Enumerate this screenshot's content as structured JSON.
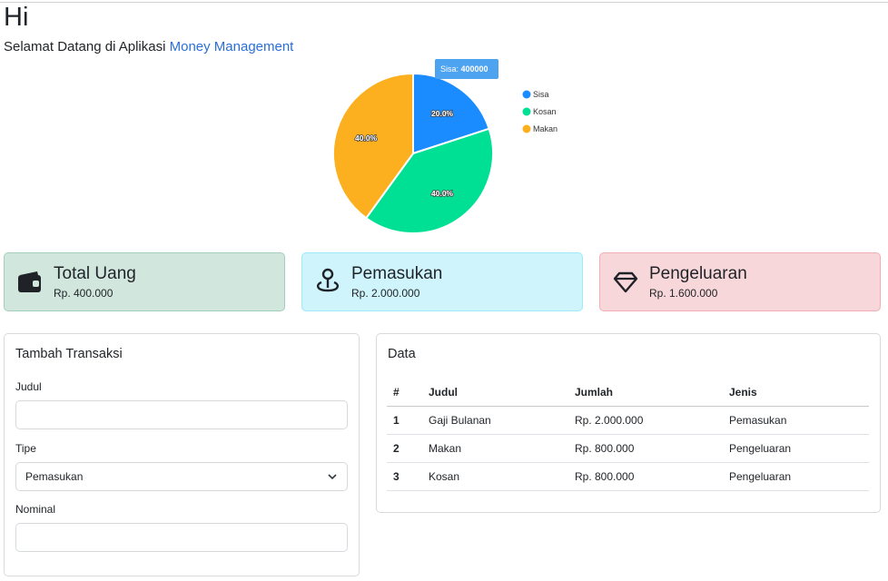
{
  "greeting": "Hi",
  "welcome": {
    "prefix": "Selamat Datang di Aplikasi",
    "brand": "Money Management"
  },
  "colors": {
    "sisa": "#1a8cff",
    "kosan": "#00e094",
    "makan": "#fdb01f",
    "brand": "#2b6fd6"
  },
  "chart_data": {
    "type": "pie",
    "categories": [
      "Sisa",
      "Kosan",
      "Makan"
    ],
    "values": [
      400000,
      800000,
      800000
    ],
    "percent_labels": [
      "20.0%",
      "40.0%",
      "40.0%"
    ],
    "legend_placement": "right",
    "tooltip": {
      "label": "Sisa:",
      "value": "400000"
    }
  },
  "cards": {
    "total": {
      "title": "Total Uang",
      "value": "Rp. 400.000",
      "icon": "wallet-icon"
    },
    "income": {
      "title": "Pemasukan",
      "value": "Rp. 2.000.000",
      "icon": "pin-icon"
    },
    "expense": {
      "title": "Pengeluaran",
      "value": "Rp. 1.600.000",
      "icon": "gem-icon"
    }
  },
  "form": {
    "title": "Tambah Transaksi",
    "judul_label": "Judul",
    "judul_value": "",
    "tipe_label": "Tipe",
    "tipe_selected": "Pemasukan",
    "nominal_label": "Nominal",
    "nominal_value": ""
  },
  "table": {
    "title": "Data",
    "headers": [
      "#",
      "Judul",
      "Jumlah",
      "Jenis"
    ],
    "rows": [
      [
        "1",
        "Gaji Bulanan",
        "Rp. 2.000.000",
        "Pemasukan"
      ],
      [
        "2",
        "Makan",
        "Rp. 800.000",
        "Pengeluaran"
      ],
      [
        "3",
        "Kosan",
        "Rp. 800.000",
        "Pengeluaran"
      ]
    ]
  }
}
